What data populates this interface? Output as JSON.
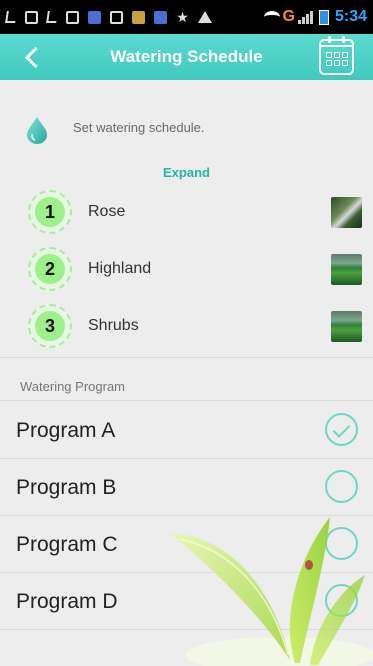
{
  "status_bar": {
    "network": "G",
    "time": "5:34"
  },
  "app_bar": {
    "title": "Watering Schedule",
    "back_icon": "chevron-left-icon",
    "calendar_icon": "calendar-icon"
  },
  "info": {
    "icon": "water-drop-icon",
    "text": "Set watering schedule.",
    "expand_label": "Expand"
  },
  "zones": [
    {
      "number": "1",
      "name": "Rose",
      "thumbnail": "rose-photo"
    },
    {
      "number": "2",
      "name": "Highland",
      "thumbnail": "landscape-photo"
    },
    {
      "number": "3",
      "name": "Shrubs",
      "thumbnail": "landscape-photo"
    }
  ],
  "programs": {
    "section_label": "Watering Program",
    "items": [
      {
        "label": "Program A",
        "selected": true
      },
      {
        "label": "Program B",
        "selected": false
      },
      {
        "label": "Program C",
        "selected": false
      },
      {
        "label": "Program D",
        "selected": false
      }
    ]
  },
  "colors": {
    "accent": "#40c9be",
    "zone_badge": "#9ef08a",
    "radio": "#6fd6c4"
  }
}
